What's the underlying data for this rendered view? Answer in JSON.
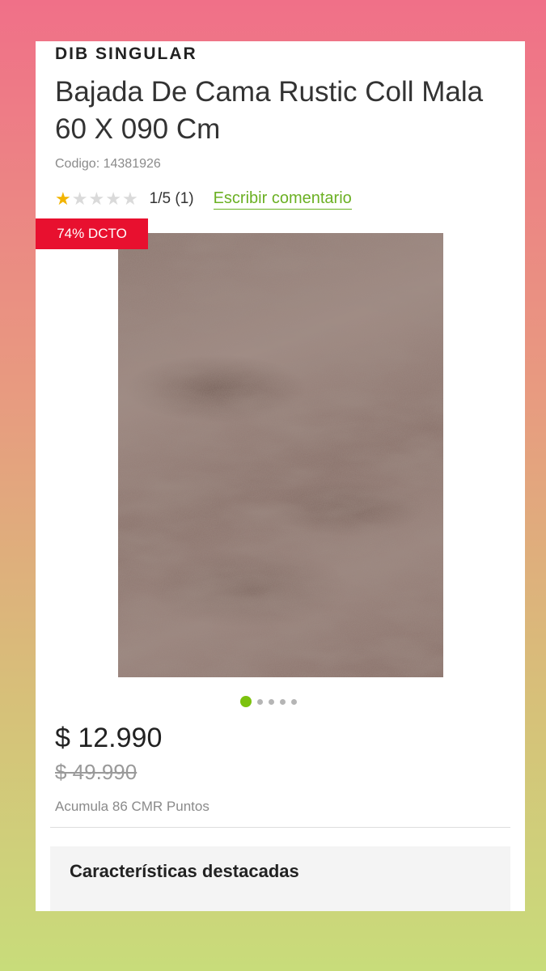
{
  "product": {
    "brand": "DIB SINGULAR",
    "title": "Bajada De Cama Rustic Coll Mala 60 X 090 Cm",
    "code": "Codigo: 14381926",
    "rating": {
      "value": 1,
      "max": 5,
      "text": "1/5 (1)",
      "review_link": "Escribir comentario"
    },
    "discount_badge": "74% DCTO",
    "image": {
      "current_slide": 1,
      "total_slides": 5
    },
    "price": "$  12.990",
    "old_price": "$  49.990",
    "points": "Acumula 86 CMR Puntos"
  },
  "features": {
    "title": "Características destacadas"
  },
  "colors": {
    "discount": "#e8102f",
    "link": "#6bb023",
    "active_dot": "#7cc20e",
    "star": "#f2b400"
  }
}
